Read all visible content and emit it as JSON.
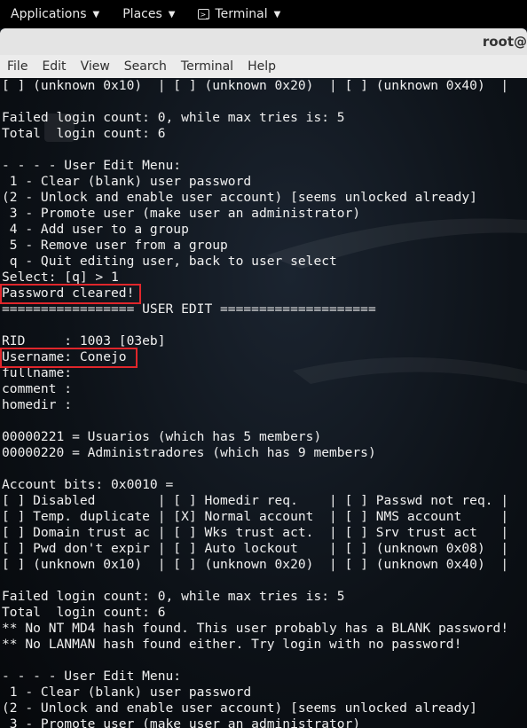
{
  "topbar": {
    "applications": "Applications",
    "places": "Places",
    "terminal": "Terminal"
  },
  "window": {
    "title": "root@"
  },
  "menubar": [
    "File",
    "Edit",
    "View",
    "Search",
    "Terminal",
    "Help"
  ],
  "terminal_lines": [
    "[ ] (unknown 0x10)  | [ ] (unknown 0x20)  | [ ] (unknown 0x40)  |",
    "",
    "Failed login count: 0, while max tries is: 5",
    "Total  login count: 6",
    "",
    "- - - - User Edit Menu:",
    " 1 - Clear (blank) user password",
    "(2 - Unlock and enable user account) [seems unlocked already]",
    " 3 - Promote user (make user an administrator)",
    " 4 - Add user to a group",
    " 5 - Remove user from a group",
    " q - Quit editing user, back to user select",
    "Select: [q] > 1",
    "Password cleared!",
    "================= USER EDIT ====================",
    "",
    "RID     : 1003 [03eb]",
    "Username: Conejo",
    "fullname:",
    "comment :",
    "homedir :",
    "",
    "00000221 = Usuarios (which has 5 members)",
    "00000220 = Administradores (which has 9 members)",
    "",
    "Account bits: 0x0010 =",
    "[ ] Disabled        | [ ] Homedir req.    | [ ] Passwd not req. |",
    "[ ] Temp. duplicate | [X] Normal account  | [ ] NMS account     |",
    "[ ] Domain trust ac | [ ] Wks trust act.  | [ ] Srv trust act   |",
    "[ ] Pwd don't expir | [ ] Auto lockout    | [ ] (unknown 0x08)  |",
    "[ ] (unknown 0x10)  | [ ] (unknown 0x20)  | [ ] (unknown 0x40)  |",
    "",
    "Failed login count: 0, while max tries is: 5",
    "Total  login count: 6",
    "** No NT MD4 hash found. This user probably has a BLANK password!",
    "** No LANMAN hash found either. Try login with no password!",
    "",
    "- - - - User Edit Menu:",
    " 1 - Clear (blank) user password",
    "(2 - Unlock and enable user account) [seems unlocked already]",
    " 3 - Promote user (make user an administrator)"
  ]
}
